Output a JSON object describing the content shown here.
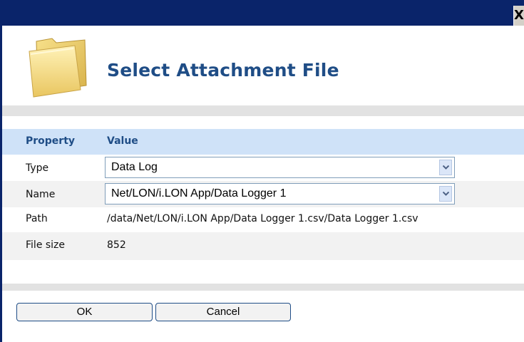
{
  "titlebar": {
    "close_label": "X"
  },
  "header": {
    "title": "Select Attachment File",
    "icon": "folder-icon"
  },
  "table": {
    "col_property": "Property",
    "col_value": "Value",
    "rows": [
      {
        "label": "Type",
        "value": "Data Log"
      },
      {
        "label": "Name",
        "value": "Net/LON/i.LON App/Data Logger 1"
      },
      {
        "label": "Path",
        "value": "/data/Net/LON/i.LON App/Data Logger 1.csv/Data Logger 1.csv"
      },
      {
        "label": "File size",
        "value": "852"
      }
    ]
  },
  "buttons": {
    "ok": "OK",
    "cancel": "Cancel"
  },
  "colors": {
    "titlebar": "#0a246a",
    "title": "#1f4d86",
    "header_row": "#cfe2f8"
  }
}
